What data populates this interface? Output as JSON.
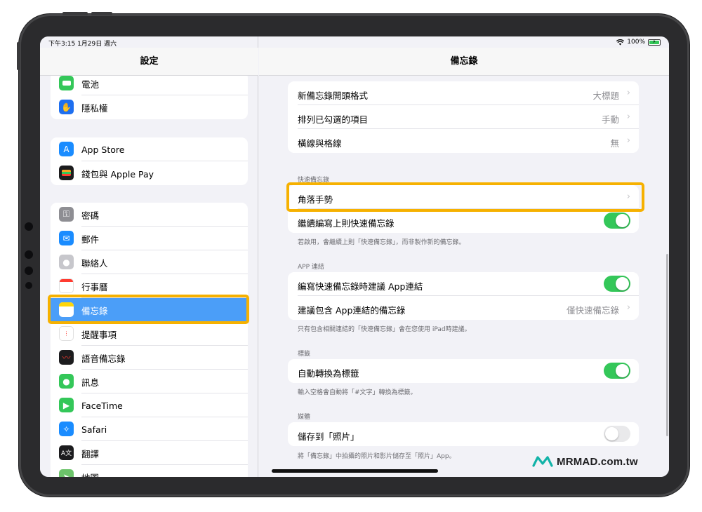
{
  "status_bar": {
    "time": "下午3:15 1月29日 週六",
    "battery": "100%"
  },
  "sidebar": {
    "title": "設定",
    "groups": [
      {
        "items": [
          {
            "label": "電池",
            "icon": "battery-icon"
          },
          {
            "label": "隱私權",
            "icon": "hand-icon"
          }
        ]
      },
      {
        "items": [
          {
            "label": "App Store",
            "icon": "app-store-icon"
          },
          {
            "label": "錢包與 Apple Pay",
            "icon": "wallet-icon"
          }
        ]
      },
      {
        "items": [
          {
            "label": "密碼",
            "icon": "key-icon"
          },
          {
            "label": "郵件",
            "icon": "mail-icon"
          },
          {
            "label": "聯絡人",
            "icon": "contacts-icon"
          },
          {
            "label": "行事曆",
            "icon": "calendar-icon"
          },
          {
            "label": "備忘錄",
            "icon": "notes-icon",
            "selected": true
          },
          {
            "label": "提醒事項",
            "icon": "reminders-icon"
          },
          {
            "label": "語音備忘錄",
            "icon": "voice-memos-icon"
          },
          {
            "label": "訊息",
            "icon": "messages-icon"
          },
          {
            "label": "FaceTime",
            "icon": "facetime-icon"
          },
          {
            "label": "Safari",
            "icon": "safari-icon"
          },
          {
            "label": "翻譯",
            "icon": "translate-icon"
          },
          {
            "label": "地圖",
            "icon": "maps-icon"
          }
        ]
      }
    ]
  },
  "detail": {
    "title": "備忘錄",
    "top_rows": [
      {
        "label": "新備忘錄開頭格式",
        "value": "大標題"
      },
      {
        "label": "排列已勾選的項目",
        "value": "手動"
      },
      {
        "label": "橫線與格線",
        "value": "無"
      }
    ],
    "quick_note": {
      "header": "快速備忘錄",
      "rows": [
        {
          "label": "角落手勢"
        },
        {
          "label": "繼續編寫上則快速備忘錄",
          "toggle": true
        }
      ],
      "footer": "若啟用，會繼續上則「快速備忘錄」，而非製作新的備忘錄。"
    },
    "app_links": {
      "header": "APP 連結",
      "rows": [
        {
          "label": "編寫快速備忘錄時建議 App連結",
          "toggle": true
        },
        {
          "label": "建議包含 App連結的備忘錄",
          "value": "僅快速備忘錄"
        }
      ],
      "footer": "只有包含相關連結的「快速備忘錄」會在您使用 iPad時建議。"
    },
    "tags": {
      "header": "標籤",
      "rows": [
        {
          "label": "自動轉換為標籤",
          "toggle": true
        }
      ],
      "footer": "輸入空格會自動將「#文字」轉換為標籤。"
    },
    "media": {
      "header": "媒體",
      "rows": [
        {
          "label": "儲存到「照片」",
          "toggle": false
        }
      ],
      "footer": "將「備忘錄」中拍攝的照片和影片儲存至「照片」App。"
    }
  },
  "watermark": {
    "text": "MRMAD.com.tw"
  },
  "colors": {
    "accent": "#4b9ef8",
    "highlight": "#f6b100",
    "toggle_on": "#34c759"
  }
}
